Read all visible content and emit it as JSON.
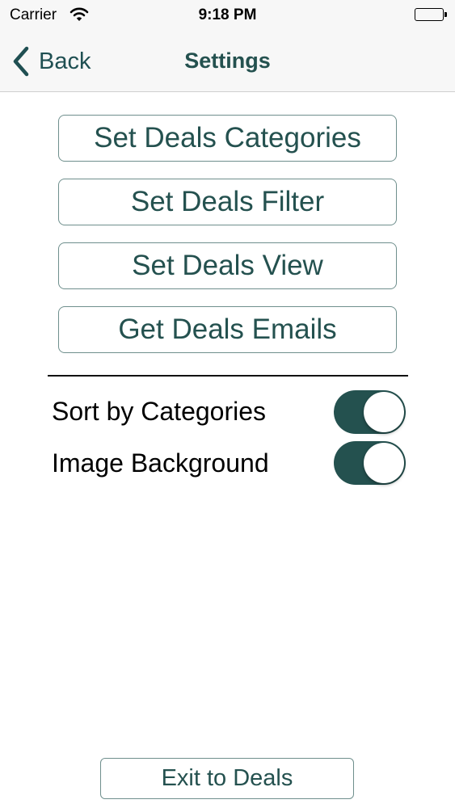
{
  "status_bar": {
    "carrier": "Carrier",
    "time": "9:18 PM"
  },
  "nav": {
    "back_label": "Back",
    "title": "Settings"
  },
  "menu": {
    "items": [
      {
        "label": "Set Deals Categories"
      },
      {
        "label": "Set Deals Filter"
      },
      {
        "label": "Set Deals View"
      },
      {
        "label": "Get Deals Emails"
      }
    ]
  },
  "settings": {
    "toggles": [
      {
        "label": "Sort by Categories",
        "on": true
      },
      {
        "label": "Image Background",
        "on": true
      }
    ]
  },
  "footer": {
    "exit_label": "Exit to Deals"
  },
  "colors": {
    "accent": "#24514f",
    "bar_background": "#f7f7f7",
    "button_border": "#6f8f8d"
  }
}
